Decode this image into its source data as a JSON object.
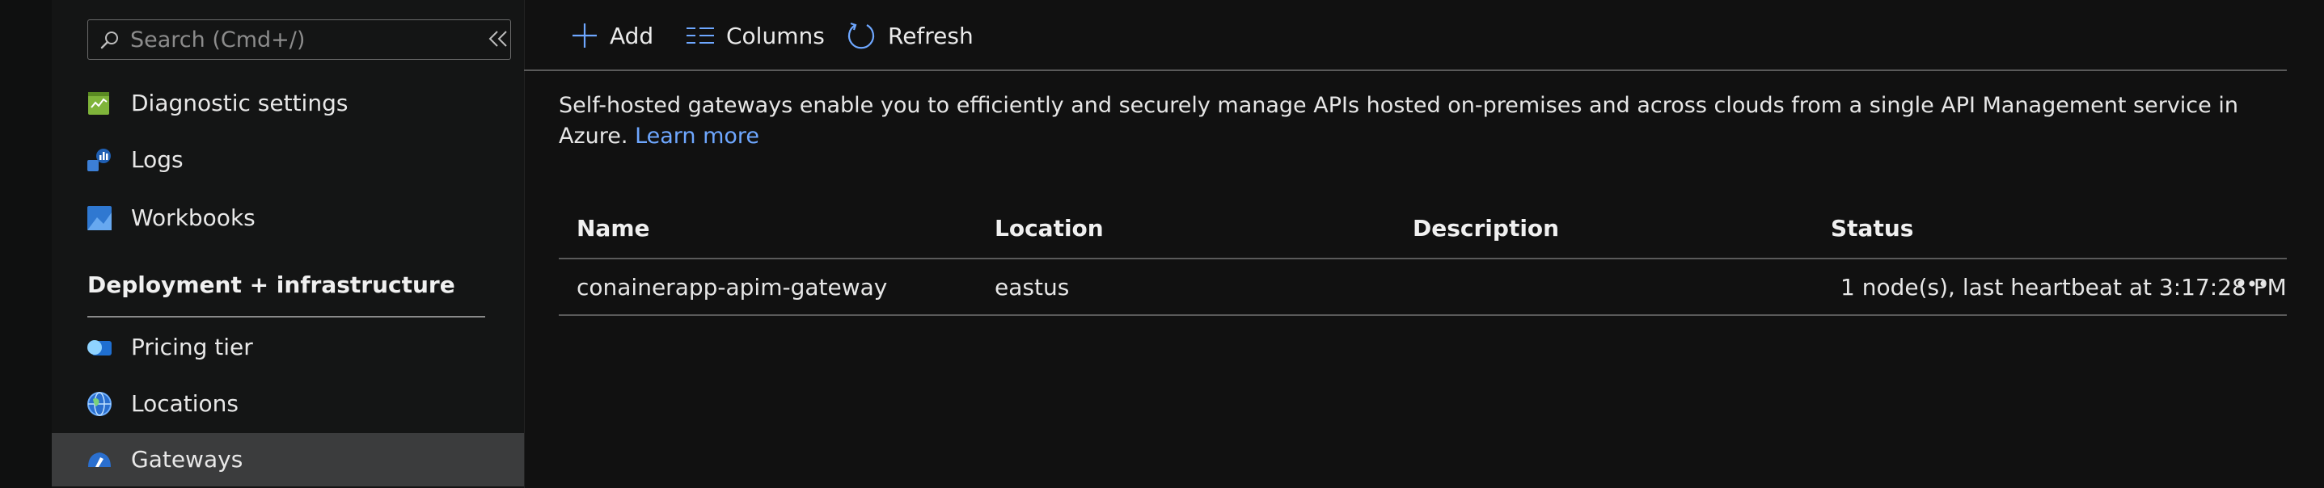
{
  "sidebar": {
    "search_placeholder": "Search (Cmd+/)",
    "items": [
      {
        "label": "Diagnostic settings",
        "icon": "diagnostic-settings-icon"
      },
      {
        "label": "Logs",
        "icon": "logs-icon"
      },
      {
        "label": "Workbooks",
        "icon": "workbooks-icon"
      }
    ],
    "section_header": "Deployment + infrastructure",
    "section_items": [
      {
        "label": "Pricing tier",
        "icon": "pricing-tier-icon"
      },
      {
        "label": "Locations",
        "icon": "locations-globe-icon"
      },
      {
        "label": "Gateways",
        "icon": "gateways-icon",
        "active": true
      }
    ]
  },
  "toolbar": {
    "add_label": "Add",
    "columns_label": "Columns",
    "refresh_label": "Refresh"
  },
  "description": {
    "text": "Self-hosted gateways enable you to efficiently and securely manage APIs hosted on-premises and across clouds from a single API Management service in Azure.",
    "link_text": "Learn more"
  },
  "table": {
    "headers": [
      "Name",
      "Location",
      "Description",
      "Status"
    ],
    "rows": [
      {
        "name": "conainerapp-apim-gateway",
        "location": "eastus",
        "description": "",
        "status": "1 node(s), last heartbeat at 3:17:28 PM"
      }
    ]
  },
  "colors": {
    "background": "#111111",
    "sidebar_bg": "#141515",
    "active_item_bg": "#3b3c3d",
    "link": "#6ea7ff",
    "accent_icon": "#4a90e2"
  }
}
